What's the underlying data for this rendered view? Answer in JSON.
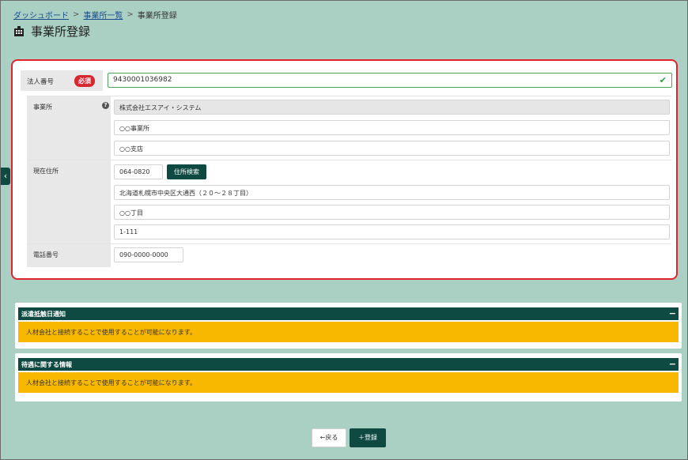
{
  "breadcrumb": {
    "items": [
      "ダッシュボード",
      "事業所一覧"
    ],
    "current": "事業所登録",
    "separator": ">"
  },
  "page": {
    "title": "事業所登録",
    "icon": "building-icon"
  },
  "form": {
    "corp_number": {
      "label": "法人番号",
      "required_badge": "必須",
      "value": "9430001036982",
      "valid": true
    },
    "office": {
      "label": "事業所",
      "help_icon": "question-icon",
      "company_name": "株式会社エスアイ・システム",
      "office_name": "○○事業所",
      "branch_name": "○○支店"
    },
    "address": {
      "label": "現在住所",
      "postal_code": "064-0820",
      "search_button": "住所検索",
      "line1": "北海道札幌市中央区大通西（２０～２８丁目）",
      "line2": "○○丁目",
      "line3": "1-111"
    },
    "phone": {
      "label": "電話番号",
      "value": "090-0000-0000"
    }
  },
  "panels": [
    {
      "title": "派遣抵触日通知",
      "toggle": "−",
      "note": "人材会社と接続することで使用することが可能になります。"
    },
    {
      "title": "待遇に関する情報",
      "toggle": "−",
      "note": "人材会社と接続することで使用することが可能になります。"
    }
  ],
  "actions": {
    "back": "←戻る",
    "save": "＋登録"
  },
  "sidebar_toggle": "‹",
  "colors": {
    "accent": "#0f4a42",
    "background": "#aacfc3",
    "highlight": "#e0242e",
    "notice": "#f8b800",
    "required": "#d8272f"
  }
}
